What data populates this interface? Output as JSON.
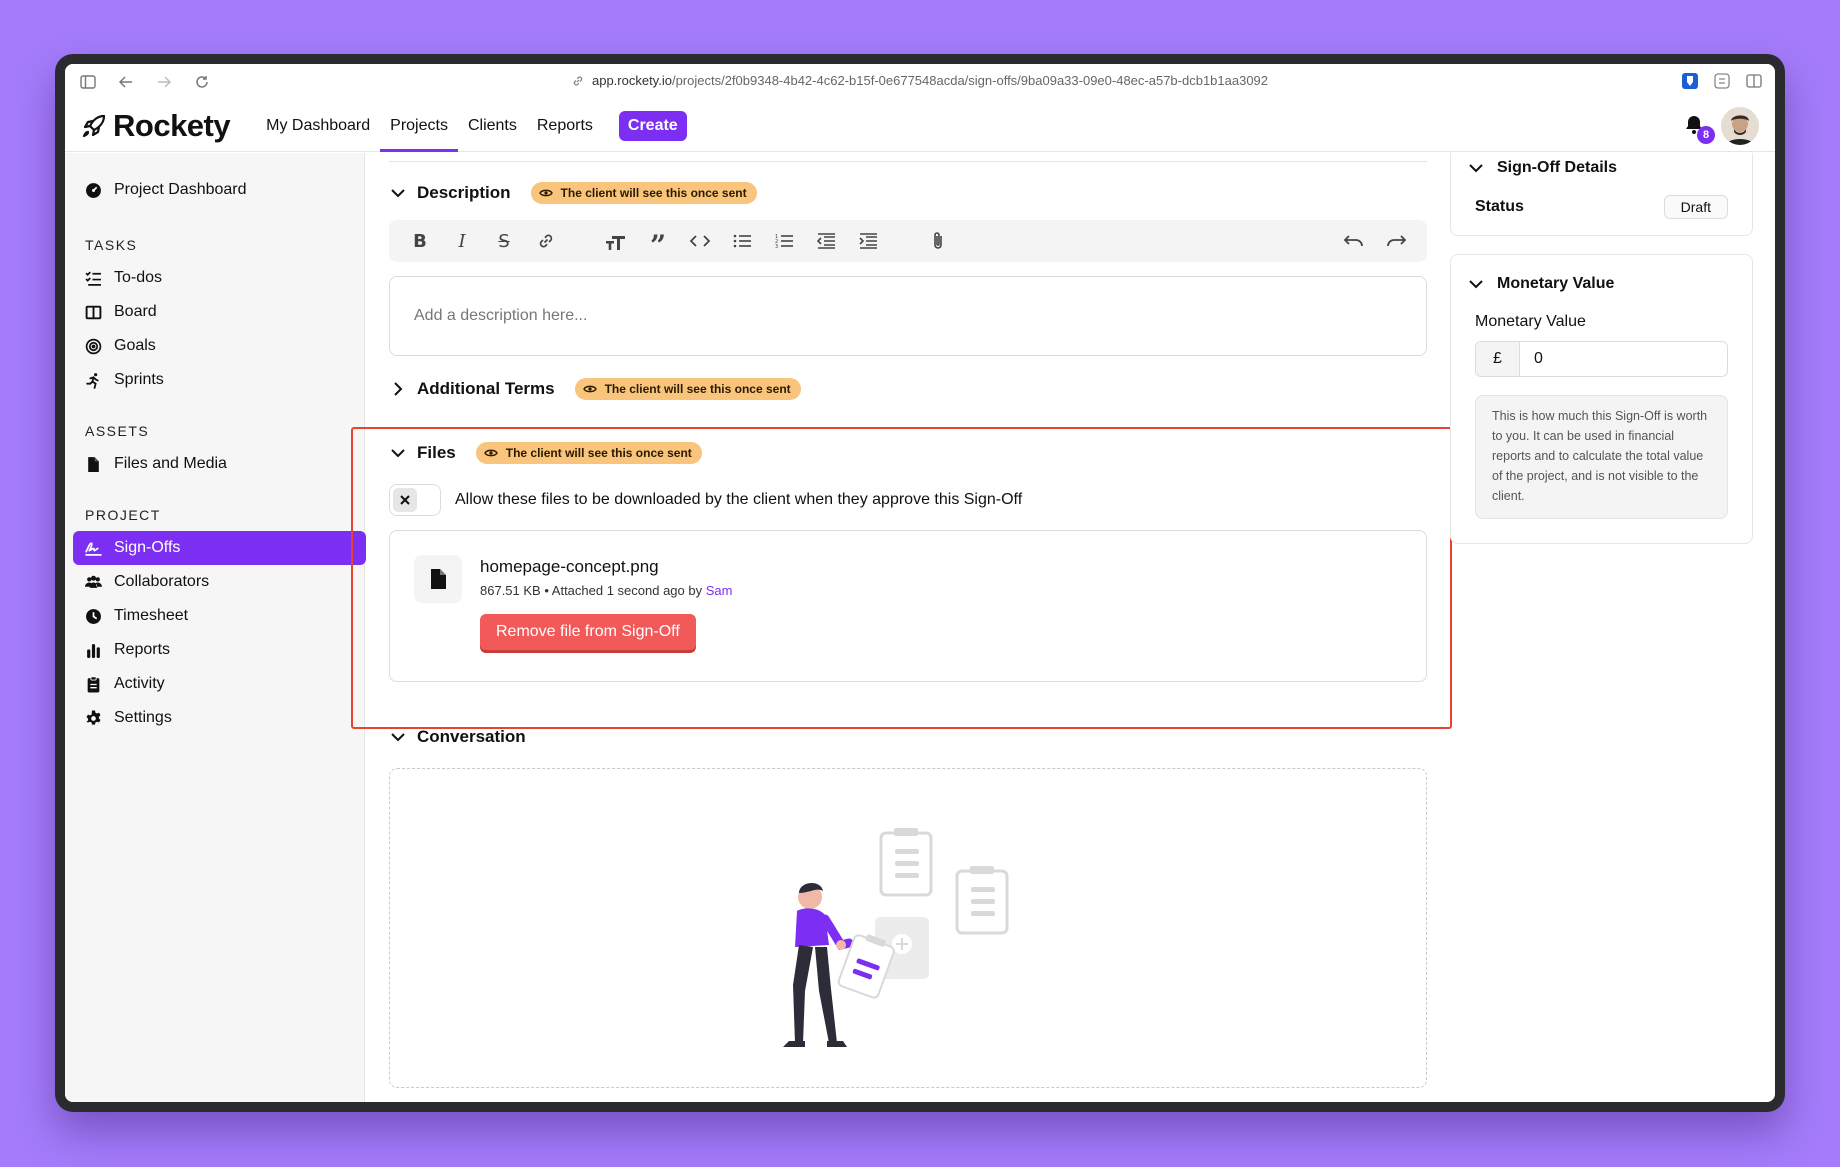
{
  "browser": {
    "url_host": "app.rockety.io",
    "url_path": "/projects/2f0b9348-4b42-4c62-b15f-0e677548acda/sign-offs/9ba09a33-09e0-48ec-a57b-dcb1b1aa3092"
  },
  "app": {
    "logo": "Rockety",
    "nav": [
      "My Dashboard",
      "Projects",
      "Clients",
      "Reports"
    ],
    "create_label": "Create",
    "notification_count": "8"
  },
  "sidebar": {
    "project_dashboard": "Project Dashboard",
    "tasks_heading": "TASKS",
    "tasks": [
      "To-dos",
      "Board",
      "Goals",
      "Sprints"
    ],
    "assets_heading": "ASSETS",
    "assets": [
      "Files and Media"
    ],
    "project_heading": "PROJECT",
    "project": [
      "Sign-Offs",
      "Collaborators",
      "Timesheet",
      "Reports",
      "Activity",
      "Settings"
    ]
  },
  "main": {
    "description_title": "Description",
    "client_badge": "The client will see this once sent",
    "description_placeholder": "Add a description here...",
    "additional_terms_title": "Additional Terms",
    "files_title": "Files",
    "allow_download_label": "Allow these files to be downloaded by the client when they approve this Sign-Off",
    "file": {
      "name": "homepage-concept.png",
      "size": "867.51 KB",
      "attached": "Attached 1 second ago by",
      "author": "Sam"
    },
    "remove_file_label": "Remove file from Sign-Off",
    "conversation_title": "Conversation"
  },
  "right": {
    "details_title": "Sign-Off Details",
    "status_label": "Status",
    "status_value": "Draft",
    "monetary_title": "Monetary Value",
    "monetary_label": "Monetary Value",
    "currency_symbol": "£",
    "monetary_value": "0",
    "monetary_help": "This is how much this Sign-Off is worth to you. It can be used in financial reports and to calculate the total value of the project, and is not visible to the client."
  },
  "colors": {
    "accent": "#7c2ff3",
    "badge": "#f9c47b",
    "danger": "#f25a5a",
    "highlight": "#e8432e",
    "background": "#a47cfb"
  }
}
